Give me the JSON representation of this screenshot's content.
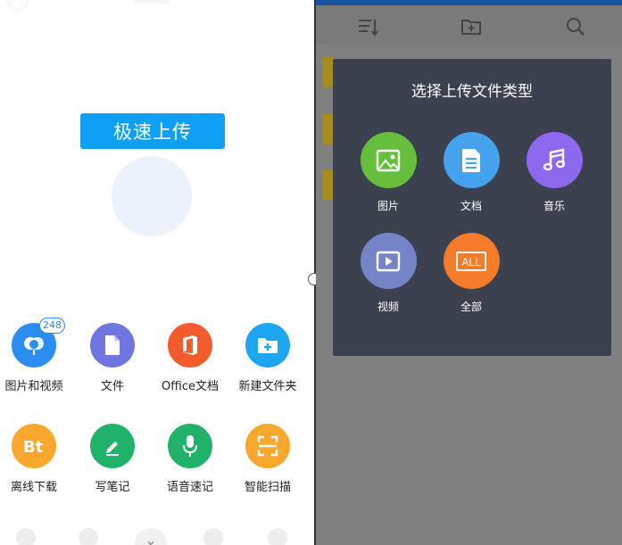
{
  "left_panel": {
    "banner_label": "极速上传",
    "actions": [
      {
        "label": "图片和视频",
        "icon": "photo-balloon-icon",
        "color": "#2b8df0",
        "badge": "248"
      },
      {
        "label": "文件",
        "icon": "file-icon",
        "color": "#6f76e0"
      },
      {
        "label": "Office文档",
        "icon": "office-icon",
        "color": "#f35b2c"
      },
      {
        "label": "新建文件夹",
        "icon": "new-folder-icon",
        "color": "#1fa6f2"
      },
      {
        "label": "离线下载",
        "icon": "bt-icon",
        "color": "#f7a72c"
      },
      {
        "label": "写笔记",
        "icon": "pen-icon",
        "color": "#20b26b"
      },
      {
        "label": "语音速记",
        "icon": "microphone-icon",
        "color": "#20b26b"
      },
      {
        "label": "智能扫描",
        "icon": "scan-icon",
        "color": "#f7a72c"
      }
    ],
    "close_glyph": "⌄"
  },
  "right_panel": {
    "dialog_title": "选择上传文件类型",
    "file_types": [
      {
        "label": "图片",
        "icon": "image-icon",
        "color": "#67be3c"
      },
      {
        "label": "文档",
        "icon": "document-icon",
        "color": "#45a2ed"
      },
      {
        "label": "音乐",
        "icon": "music-icon",
        "color": "#8d69ee"
      },
      {
        "label": "视频",
        "icon": "video-icon",
        "color": "#7584c6"
      },
      {
        "label": "全部",
        "icon": "all-icon",
        "color": "#f47b2a",
        "icon_text": "ALL"
      }
    ]
  }
}
